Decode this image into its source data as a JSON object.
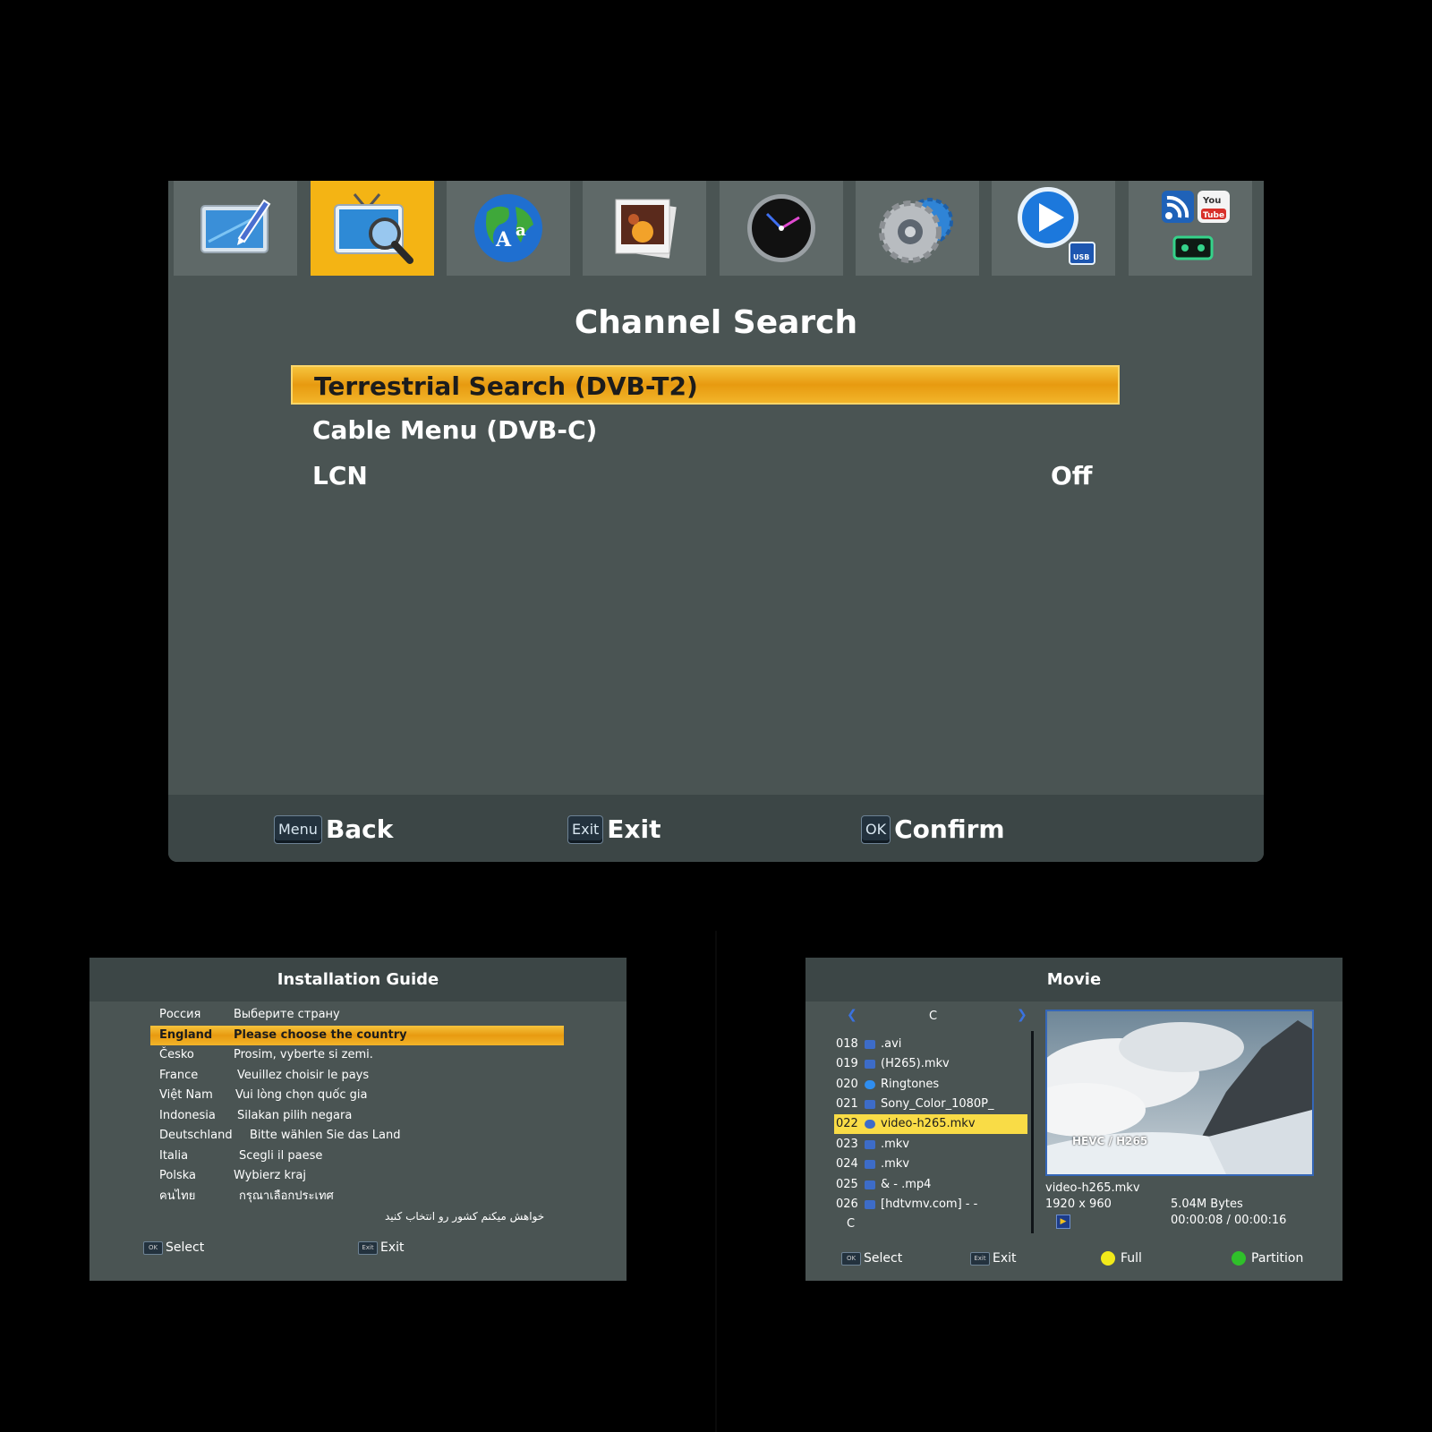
{
  "colors": {
    "panel_bg": "#4a5453",
    "header_bg": "#3c4646",
    "highlight": "#f4b414",
    "tile_bg": "#5f6968"
  },
  "main_menu": {
    "icons": [
      "edit-tv-icon",
      "channel-search-icon",
      "language-globe-icon",
      "photo-icon",
      "clock-icon",
      "gear-icon",
      "usb-play-icon",
      "apps-icon"
    ],
    "active_icon": 1,
    "title": "Channel Search",
    "items": [
      {
        "label": "Terrestrial Search (DVB-T2)",
        "value": ""
      },
      {
        "label": "Cable Menu (DVB-C)",
        "value": ""
      },
      {
        "label": "LCN",
        "value": "Off"
      }
    ],
    "selected_index": 0,
    "footer": [
      {
        "key": "Menu",
        "label": "Back"
      },
      {
        "key": "Exit",
        "label": "Exit"
      },
      {
        "key": "OK",
        "label": "Confirm"
      }
    ]
  },
  "installation_guide": {
    "title": "Installation Guide",
    "rows": [
      {
        "lang": "Россия",
        "prompt": "Выберите страну"
      },
      {
        "lang": "England",
        "prompt": "Please choose the country"
      },
      {
        "lang": "Česko",
        "prompt": "Prosim, vyberte si zemi."
      },
      {
        "lang": "France",
        "prompt": "Veuillez choisir le pays"
      },
      {
        "lang": "Việt Nam",
        "prompt": "Vui lòng chọn quốc gia"
      },
      {
        "lang": "Indonesia",
        "prompt": "Silakan pilih negara"
      },
      {
        "lang": "Deutschland",
        "prompt": "Bitte wählen Sie das Land"
      },
      {
        "lang": "Italia",
        "prompt": "Scegli il paese"
      },
      {
        "lang": "Polska",
        "prompt": "Wybierz kraj"
      },
      {
        "lang": "คนไทย",
        "prompt": "กรุณาเลือกประเทศ"
      }
    ],
    "rtl_prompt": "خواهش میکنم کشور رو انتخاب کنید",
    "selected_index": 1,
    "footer": [
      {
        "key": "OK",
        "label": "Select"
      },
      {
        "key": "Exit",
        "label": "Exit"
      }
    ]
  },
  "movie": {
    "title": "Movie",
    "drive": "C",
    "files": [
      {
        "num": "018",
        "name": ".avi"
      },
      {
        "num": "019",
        "name": "(H265).mkv"
      },
      {
        "num": "020",
        "name": "Ringtones"
      },
      {
        "num": "021",
        "name": "Sony_Color_1080P_"
      },
      {
        "num": "022",
        "name": "video-h265.mkv"
      },
      {
        "num": "023",
        "name": " .mkv"
      },
      {
        "num": "024",
        "name": ".mkv"
      },
      {
        "num": "025",
        "name": "& -  .mp4"
      },
      {
        "num": "026",
        "name": "[hdtvmv.com] -  -"
      }
    ],
    "footer_drive": "C",
    "selected_index": 4,
    "preview_overlay": "HEVC / H265",
    "info": {
      "filename": "video-h265.mkv",
      "resolution": "1920 x 960",
      "size": "5.04M Bytes",
      "time": "00:00:08 / 00:00:16"
    },
    "footer": [
      {
        "key": "OK",
        "label": "Select"
      },
      {
        "key": "Exit",
        "label": "Exit"
      },
      {
        "key": "yellow-dot",
        "label": "Full"
      },
      {
        "key": "green-dot",
        "label": "Partition"
      }
    ]
  }
}
